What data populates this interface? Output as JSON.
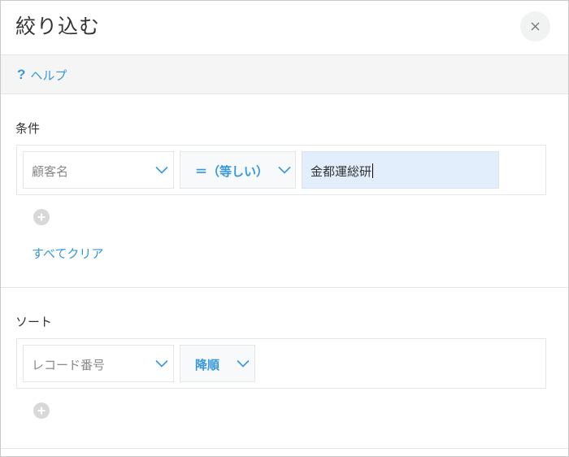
{
  "dialog": {
    "title": "絞り込む",
    "close_icon": "close-icon"
  },
  "help": {
    "icon": "?",
    "label": "ヘルプ"
  },
  "conditions": {
    "label": "条件",
    "field_value": "顧客名",
    "operator_value": "＝（等しい）",
    "input_value": "金都運総研",
    "add_icon": "plus-circle-icon",
    "clear_all_label": "すべてクリア"
  },
  "sort": {
    "label": "ソート",
    "field_value": "レコード番号",
    "order_value": "降順",
    "add_icon": "plus-circle-icon"
  },
  "colors": {
    "accent": "#3498db",
    "input_bg": "#e2eefb",
    "help_bar_bg": "#f5f5f5",
    "add_button": "#d8d8d8"
  }
}
